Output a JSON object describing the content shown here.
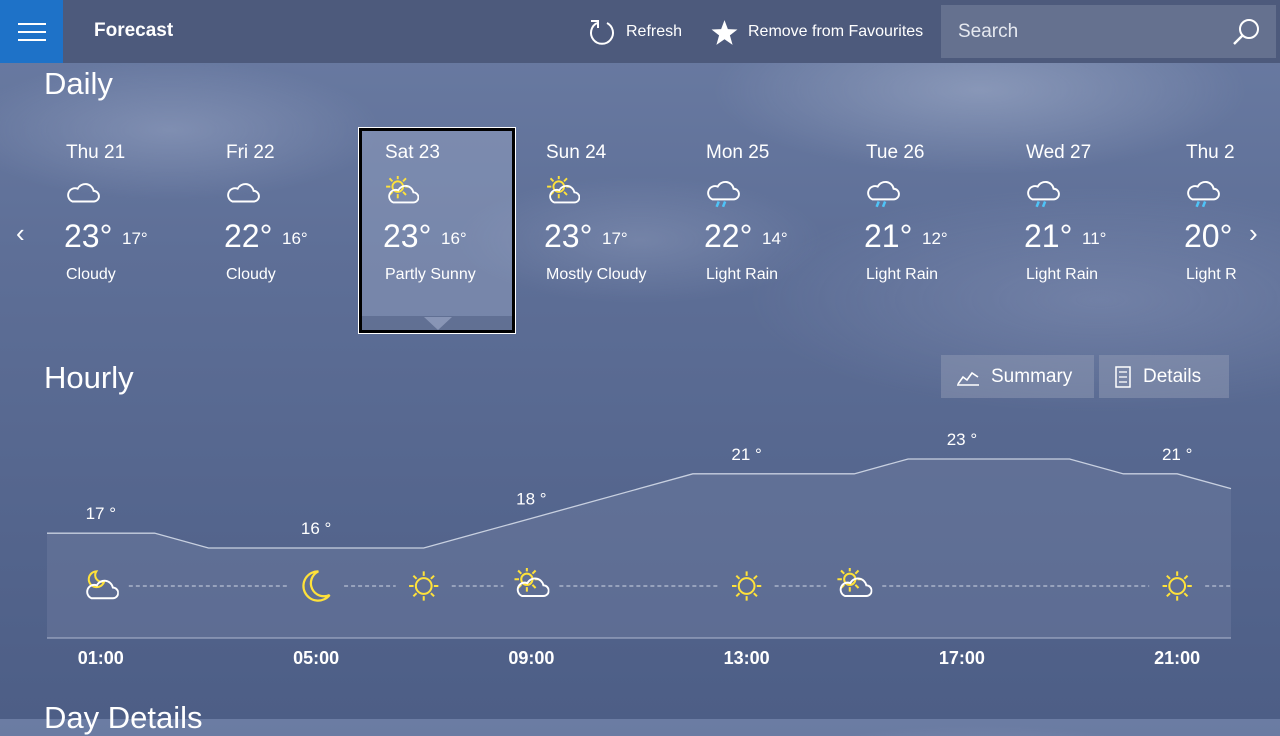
{
  "header": {
    "menu_icon": "hamburger-icon",
    "title": "Forecast",
    "refresh_label": "Refresh",
    "favourite_label": "Remove from Favourites",
    "search_placeholder": "Search"
  },
  "sections": {
    "daily": "Daily",
    "hourly": "Hourly",
    "day_details": "Day Details"
  },
  "daily": [
    {
      "day": "Thu 21",
      "hi": "23°",
      "lo": "17°",
      "condition": "Cloudy",
      "icon": "cloudy-icon"
    },
    {
      "day": "Fri 22",
      "hi": "22°",
      "lo": "16°",
      "condition": "Cloudy",
      "icon": "cloudy-icon"
    },
    {
      "day": "Sat 23",
      "hi": "23°",
      "lo": "16°",
      "condition": "Partly Sunny",
      "icon": "partly-sunny-icon",
      "selected": true
    },
    {
      "day": "Sun 24",
      "hi": "23°",
      "lo": "17°",
      "condition": "Mostly Cloudy",
      "icon": "mostly-cloudy-icon"
    },
    {
      "day": "Mon 25",
      "hi": "22°",
      "lo": "14°",
      "condition": "Light Rain",
      "icon": "light-rain-icon"
    },
    {
      "day": "Tue 26",
      "hi": "21°",
      "lo": "12°",
      "condition": "Light Rain",
      "icon": "light-rain-icon"
    },
    {
      "day": "Wed 27",
      "hi": "21°",
      "lo": "11°",
      "condition": "Light Rain",
      "icon": "light-rain-icon"
    },
    {
      "day": "Thu 2",
      "hi": "20°",
      "lo": "",
      "condition": "Light R",
      "icon": "light-rain-icon"
    }
  ],
  "hourly_toggle": {
    "summary_label": "Summary",
    "details_label": "Details"
  },
  "colors": {
    "sun": "#ffe23a",
    "accent": "#1e72c8",
    "topbar": "#4d5a7c"
  },
  "chart_data": {
    "type": "area",
    "hours": [
      0,
      1,
      2,
      3,
      4,
      5,
      6,
      7,
      8,
      9,
      10,
      11,
      12,
      13,
      14,
      15,
      16,
      17,
      18,
      19,
      20,
      21,
      22
    ],
    "temps": [
      17,
      17,
      17,
      16,
      16,
      16,
      16,
      16,
      17,
      18,
      19,
      20,
      21,
      21,
      21,
      21,
      22,
      22,
      22,
      22,
      21,
      21,
      20
    ],
    "labels": [
      {
        "hour": 1,
        "text": "17 °"
      },
      {
        "hour": 5,
        "text": "16 °"
      },
      {
        "hour": 9,
        "text": "18 °"
      },
      {
        "hour": 13,
        "text": "21 °"
      },
      {
        "hour": 17,
        "text": "23 °"
      },
      {
        "hour": 21,
        "text": "21 °"
      }
    ],
    "xticks": [
      {
        "hour": 1,
        "text": "01:00"
      },
      {
        "hour": 5,
        "text": "05:00"
      },
      {
        "hour": 9,
        "text": "09:00"
      },
      {
        "hour": 13,
        "text": "13:00"
      },
      {
        "hour": 17,
        "text": "17:00"
      },
      {
        "hour": 21,
        "text": "21:00"
      }
    ],
    "icons": [
      {
        "hour": 1,
        "icon": "partly-cloudy-night-icon"
      },
      {
        "hour": 5,
        "icon": "moon-icon"
      },
      {
        "hour": 7,
        "icon": "sun-icon"
      },
      {
        "hour": 9,
        "icon": "partly-sunny-icon"
      },
      {
        "hour": 13,
        "icon": "sun-icon"
      },
      {
        "hour": 15,
        "icon": "partly-sunny-icon"
      },
      {
        "hour": 21,
        "icon": "sun-icon"
      }
    ]
  }
}
